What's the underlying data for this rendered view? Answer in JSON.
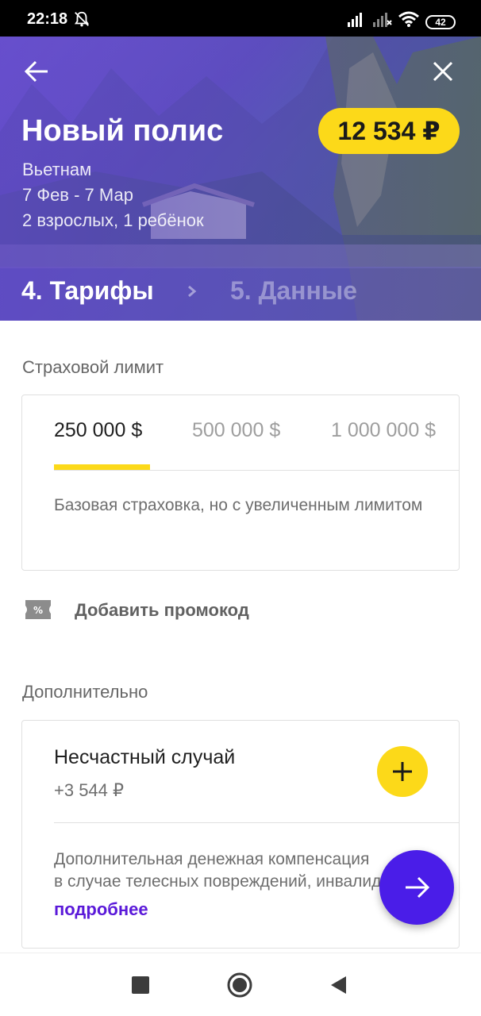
{
  "status_bar": {
    "time": "22:18",
    "battery": "42"
  },
  "hero": {
    "title": "Новый полис",
    "price": "12 534 ₽",
    "destination": "Вьетнам",
    "dates": "7 Фев - 7 Мар",
    "travelers": "2 взрослых, 1 ребёнок",
    "step_current": "4. Тарифы",
    "step_next": "5. Данные"
  },
  "limit": {
    "label": "Страховой лимит",
    "options": [
      "250 000 $",
      "500 000 $",
      "1 000 000 $"
    ],
    "selected_index": 0,
    "description": "Базовая страховка, но с увеличенным лимитом"
  },
  "promo": {
    "label": "Добавить промокод"
  },
  "extras": {
    "label": "Дополнительно",
    "items": [
      {
        "title": "Несчастный случай",
        "price": "+3 544 ₽",
        "description_line1": "Дополнительная денежная компенсация",
        "description_line2": "в случае телесных повреждений, инвалидности",
        "more": "подробнее"
      }
    ]
  },
  "colors": {
    "accent_yellow": "#fcd919",
    "accent_purple": "#4a1de8",
    "link_purple": "#5a19d9"
  },
  "icons": {
    "back": "arrow-left-icon",
    "close": "close-icon",
    "promo": "ticket-percent-icon",
    "add": "plus-icon",
    "next": "arrow-right-icon"
  }
}
